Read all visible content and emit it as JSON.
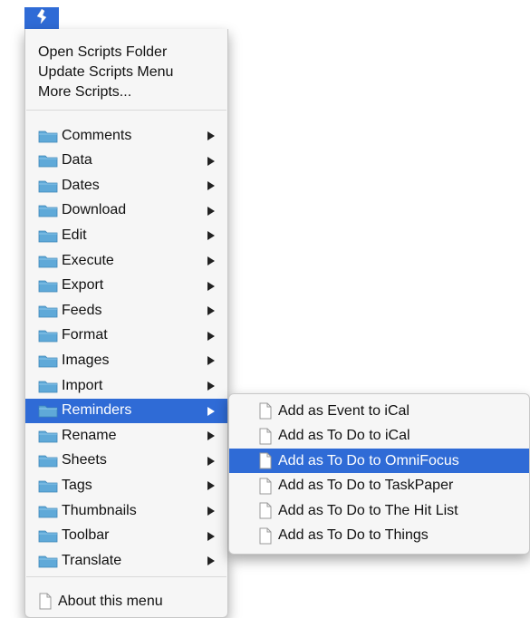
{
  "menubar": {
    "icon": "script-icon"
  },
  "menu": {
    "top_items": [
      "Open Scripts Folder",
      "Update Scripts Menu",
      "More Scripts..."
    ],
    "folders": [
      "Comments",
      "Data",
      "Dates",
      "Download",
      "Edit",
      "Execute",
      "Export",
      "Feeds",
      "Format",
      "Images",
      "Import",
      "Reminders",
      "Rename",
      "Sheets",
      "Tags",
      "Thumbnails",
      "Toolbar",
      "Translate"
    ],
    "selected_folder": "Reminders",
    "bottom_item": "About this menu"
  },
  "submenu": {
    "items": [
      "Add as Event to iCal",
      "Add as To Do to iCal",
      "Add as To Do to OmniFocus",
      "Add as To Do to TaskPaper",
      "Add as To Do to The Hit List",
      "Add as To Do to Things"
    ],
    "selected_item": "Add as To Do to OmniFocus"
  },
  "colors": {
    "selection": "#2f6bd6",
    "folder": "#5fa9d8"
  }
}
